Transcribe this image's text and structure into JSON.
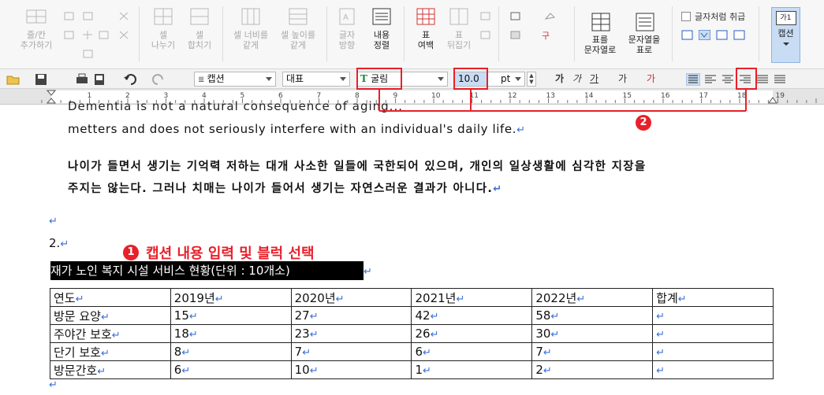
{
  "ribbon": {
    "insert_row_col": "줄/칸\n추가하기",
    "split_cell": "셀\n나누기",
    "merge_cell": "셀\n합치기",
    "equal_width": "셀 너비를\n같게",
    "equal_height": "셀 높이를\n같게",
    "text_direction": "글자\n방향",
    "content_align": "내용\n정렬",
    "table_margin": "표\n여백",
    "table_flip": "표\n뒤집기",
    "table_to_text": "표를\n문자열로",
    "text_to_table": "문자열을\n표로",
    "treat_as_char": "글자처럼 취급",
    "caption_icon_text": "가1",
    "caption": "캡션"
  },
  "toolbar": {
    "style": "캡션",
    "font_lang": "대표",
    "font_name": "굴림",
    "font_size": "10.0",
    "size_unit": "pt",
    "bold": "가",
    "italic": "가",
    "underline": "가",
    "strike": "가",
    "color": "가"
  },
  "annotations": {
    "badge1": "1",
    "label1": "캡션 내용 입력 및 블럭 선택",
    "badge2": "2"
  },
  "document": {
    "line_cut": "Dementia is not a natural consequence of aging... ",
    "line1": "metters and does not seriously interfere with an individual's daily life.",
    "ko_line1": "나이가 들면서 생기는 기억력 저하는 대개 사소한 일들에 국한되어 있으며, 개인의 일상생활에 심각한 지장을",
    "ko_line2": "주지는 않는다. 그러나 치매는 나이가 들어서 생기는 자연스러운 결과가 아니다.",
    "item_num": "2.",
    "caption_text": "재가 노인 복지 시설 서비스 현황(단위 : 10개소)",
    "return_mark": "↵"
  },
  "table": {
    "header": [
      "연도",
      "2019년",
      "2020년",
      "2021년",
      "2022년",
      "합계"
    ],
    "rows": [
      [
        "방문 요양",
        "15",
        "27",
        "42",
        "58",
        ""
      ],
      [
        "주야간 보호",
        "18",
        "23",
        "26",
        "30",
        ""
      ],
      [
        "단기 보호",
        "8",
        "7",
        "6",
        "7",
        ""
      ],
      [
        "방문간호",
        "6",
        "10",
        "1",
        "2",
        ""
      ]
    ]
  },
  "ruler_ticks": [
    "1",
    "2",
    "3",
    "4",
    "5",
    "6",
    "7",
    "8",
    "9",
    "10",
    "11",
    "12",
    "13",
    "14",
    "15",
    "16",
    "17",
    "18",
    "19"
  ],
  "colors": {
    "annotation_red": "#e8202a",
    "selection": "#000000",
    "active_blue": "#c8dcf4"
  }
}
